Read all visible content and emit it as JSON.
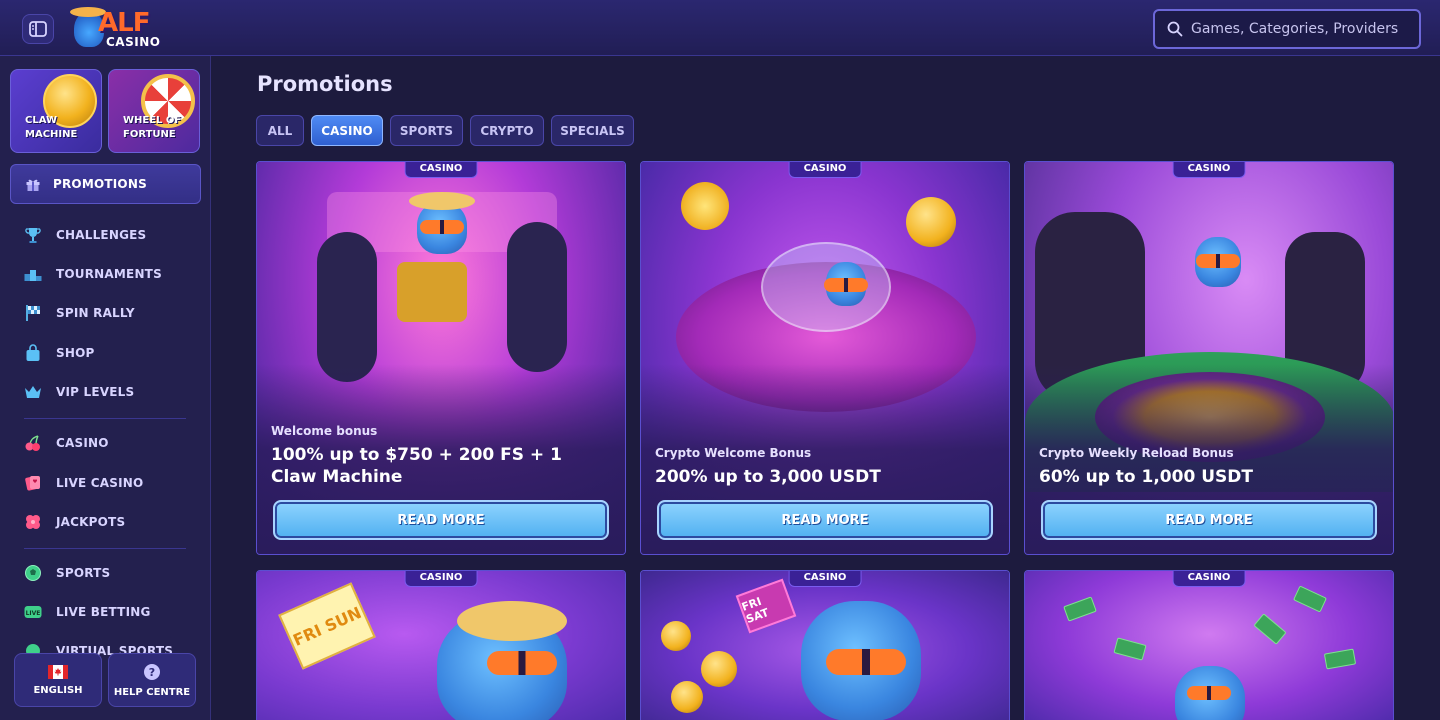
{
  "header": {
    "logo_text": "ALF",
    "logo_sub": "CASINO",
    "search_placeholder": "Games, Categories, Providers"
  },
  "sidebar": {
    "features": [
      {
        "label_line1": "CLAW",
        "label_line2": "MACHINE"
      },
      {
        "label_line1": "WHEEL OF",
        "label_line2": "FORTUNE"
      }
    ],
    "promotions_label": "PROMOTIONS",
    "items": [
      {
        "label": "CHALLENGES",
        "icon": "trophy-icon"
      },
      {
        "label": "TOURNAMENTS",
        "icon": "podium-icon"
      },
      {
        "label": "SPIN RALLY",
        "icon": "checkered-flag-icon"
      },
      {
        "label": "SHOP",
        "icon": "shopping-bag-icon"
      },
      {
        "label": "VIP LEVELS",
        "icon": "crown-icon"
      },
      {
        "label": "CASINO",
        "icon": "cherries-icon"
      },
      {
        "label": "LIVE CASINO",
        "icon": "cards-icon"
      },
      {
        "label": "JACKPOTS",
        "icon": "clover-icon"
      },
      {
        "label": "SPORTS",
        "icon": "soccer-ball-icon"
      },
      {
        "label": "LIVE BETTING",
        "icon": "live-badge-icon",
        "badge": "LIVE"
      },
      {
        "label": "VIRTUAL SPORTS",
        "icon": "virtual-sports-icon"
      }
    ],
    "language_label": "ENGLISH",
    "help_label": "HELP CENTRE",
    "help_glyph": "?"
  },
  "main": {
    "title": "Promotions",
    "filters": [
      {
        "label": "ALL",
        "active": false
      },
      {
        "label": "CASINO",
        "active": true
      },
      {
        "label": "SPORTS",
        "active": false
      },
      {
        "label": "CRYPTO",
        "active": false
      },
      {
        "label": "SPECIALS",
        "active": false
      }
    ],
    "cards": [
      {
        "badge": "CASINO",
        "eyebrow": "Welcome bonus",
        "headline": "100% up to $750 + 200 FS + 1 Claw Machine",
        "cta": "READ MORE"
      },
      {
        "badge": "CASINO",
        "eyebrow": "Crypto Welcome Bonus",
        "headline": "200% up to 3,000 USDT",
        "cta": "READ MORE"
      },
      {
        "badge": "CASINO",
        "eyebrow": "Crypto Weekly Reload Bonus",
        "headline": "60% up to 1,000 USDT",
        "cta": "READ MORE"
      },
      {
        "badge": "CASINO",
        "sign_text": "FRI SUN"
      },
      {
        "badge": "CASINO",
        "sign_text": "FRI SAT"
      },
      {
        "badge": "CASINO"
      }
    ]
  },
  "colors": {
    "background": "#1d1b3e",
    "accent": "#4f8bf4",
    "cta": "#4fb0f0",
    "badge": "#3a2196"
  }
}
